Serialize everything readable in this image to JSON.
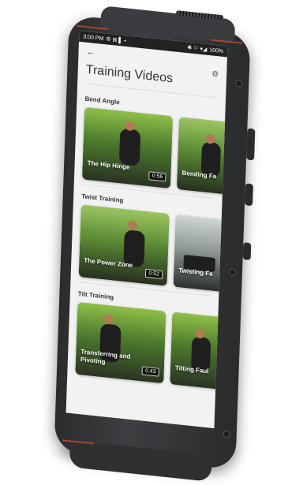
{
  "statusbar": {
    "time": "3:00 PM",
    "left_icons": "⚙ ⊠ ▌ •",
    "right_icons": "✱ ⚐ ▾◢",
    "battery": "100%"
  },
  "header": {
    "back_icon": "←",
    "title": "Training Videos",
    "settings_icon": "⚙"
  },
  "sections": [
    {
      "title": "Bend Angle",
      "videos": [
        {
          "label": "The Hip Hinge",
          "duration": "0:56"
        },
        {
          "label": "Bending Fa"
        }
      ]
    },
    {
      "title": "Twist Training",
      "videos": [
        {
          "label": "The Power Zone",
          "duration": "0:52"
        },
        {
          "label": "Twisting Fa"
        }
      ]
    },
    {
      "title": "Tilt Training",
      "videos": [
        {
          "label": "Transferring and Pivoting",
          "duration": "0:43"
        },
        {
          "label": "Tilting Faul"
        }
      ]
    }
  ],
  "colors": {
    "status_bar": "#222222",
    "screen_bg": "#f2f2f2",
    "accent_trim": "#b5512a"
  }
}
